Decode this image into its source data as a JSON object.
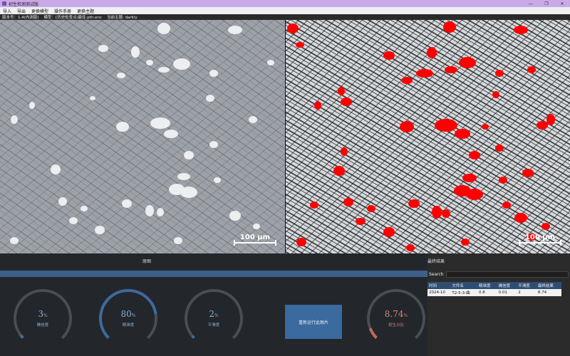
{
  "window": {
    "title": "初生检测测试版",
    "minimize": "—",
    "maximize": "❐",
    "close": "✕"
  },
  "menu": [
    "导入",
    "导出",
    "更换模型",
    "操作手册",
    "更换主题"
  ],
  "status": {
    "version": "版本号：1.4(内测版)",
    "model": "模型：[历史检查点/最佳.pth.enc",
    "theme": "当前主题: darkly"
  },
  "images": {
    "left_scale": "100 μm",
    "right_scale": "100 μm"
  },
  "left_panel": {
    "title": "原图",
    "gauges": [
      {
        "value": "3",
        "unit": "%",
        "label": "确信度",
        "fraction": 0.03
      },
      {
        "value": "80",
        "unit": "%",
        "label": "精准度",
        "fraction": 0.8
      },
      {
        "value": "2",
        "unit": "%",
        "label": "平滑度",
        "fraction": 0.02
      }
    ],
    "rerun_label": "重新运行此图片",
    "result_gauge": {
      "value": "8.74",
      "unit": "%",
      "label": "初生占比",
      "fraction": 0.0874
    }
  },
  "right_panel": {
    "title": "最终结果",
    "search_label": "Search",
    "columns": [
      "时间",
      "文件名",
      "精准度",
      "确信度",
      "平滑度",
      "最终结果"
    ],
    "rows": [
      [
        "2024-10",
        "T2-5-3-曲",
        "0.8",
        "0.01",
        "2",
        "8.74"
      ]
    ]
  },
  "colors": {
    "accent": "#3b6a9e",
    "titlebar": "#c9a9e8",
    "overlay": "#ff0000"
  }
}
